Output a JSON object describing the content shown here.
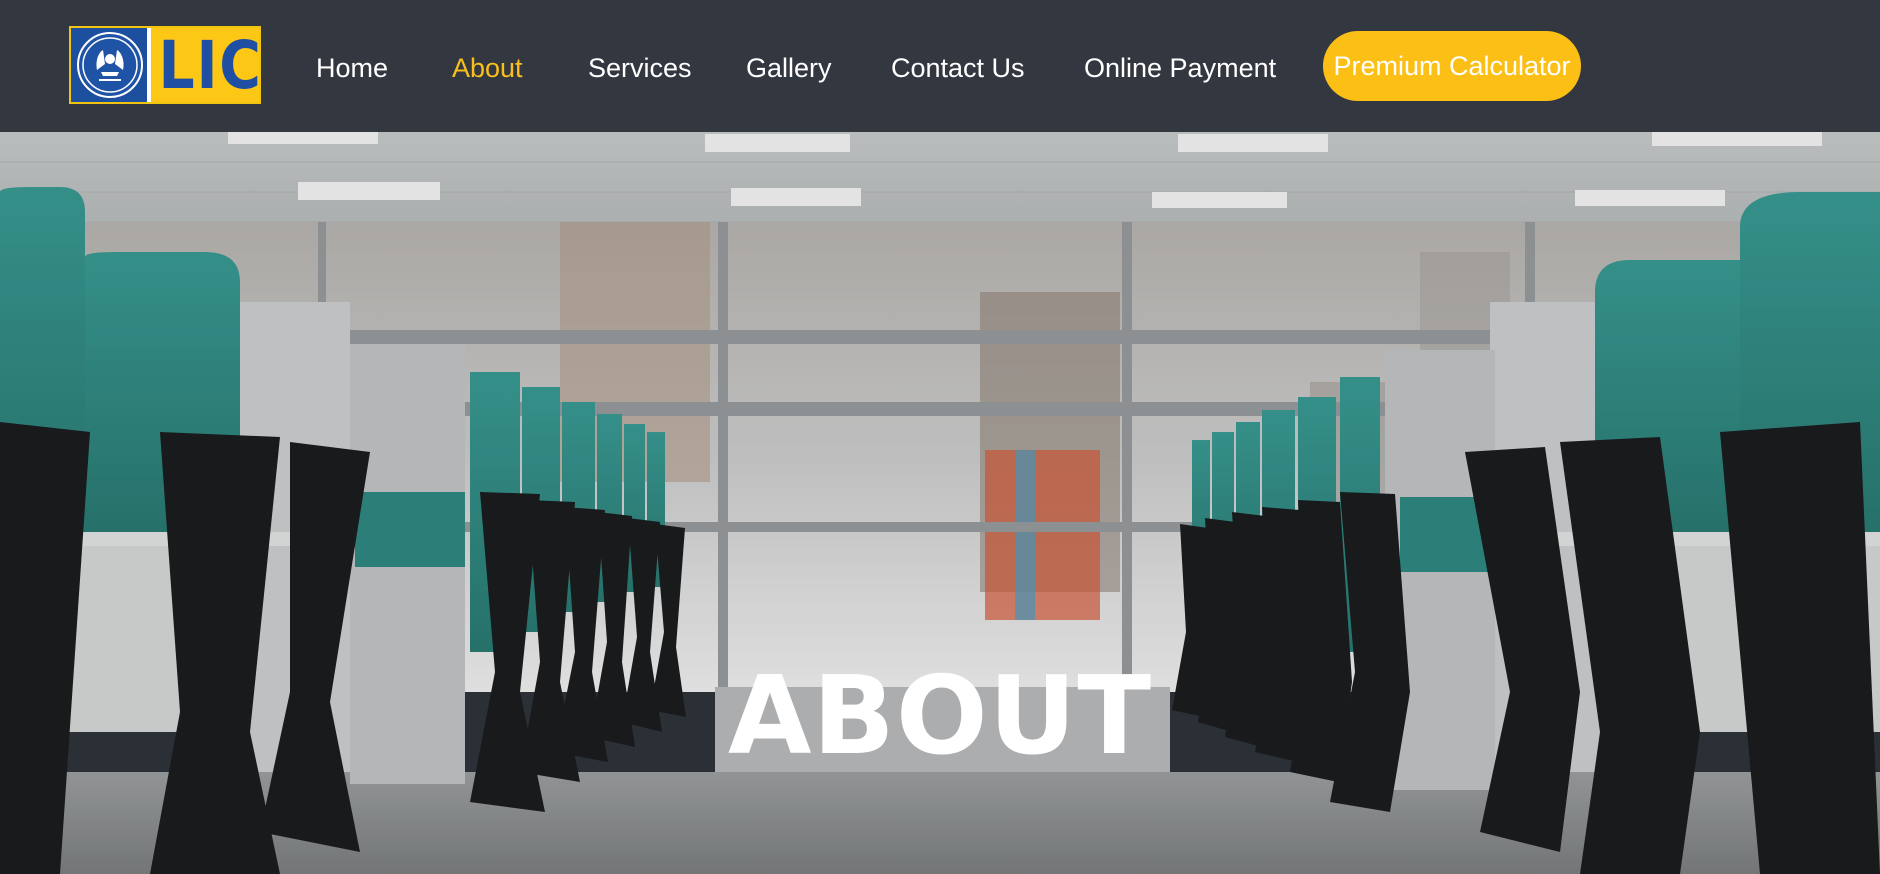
{
  "brand": {
    "logo_text": "LIC",
    "logo_colors": {
      "blue": "#1e4fa3",
      "yellow": "#fcc715"
    }
  },
  "nav": {
    "items": [
      {
        "label": "Home",
        "active": false
      },
      {
        "label": "About",
        "active": true
      },
      {
        "label": "Services",
        "active": false
      },
      {
        "label": "Gallery",
        "active": false
      },
      {
        "label": "Contact Us",
        "active": false
      },
      {
        "label": "Online Payment",
        "active": false
      }
    ],
    "cta_label": "Premium Calculator",
    "active_color": "#f9bf1c",
    "background_color": "#333740"
  },
  "hero": {
    "title": "ABOUT",
    "image_subject": "office-cubicles-photo"
  }
}
